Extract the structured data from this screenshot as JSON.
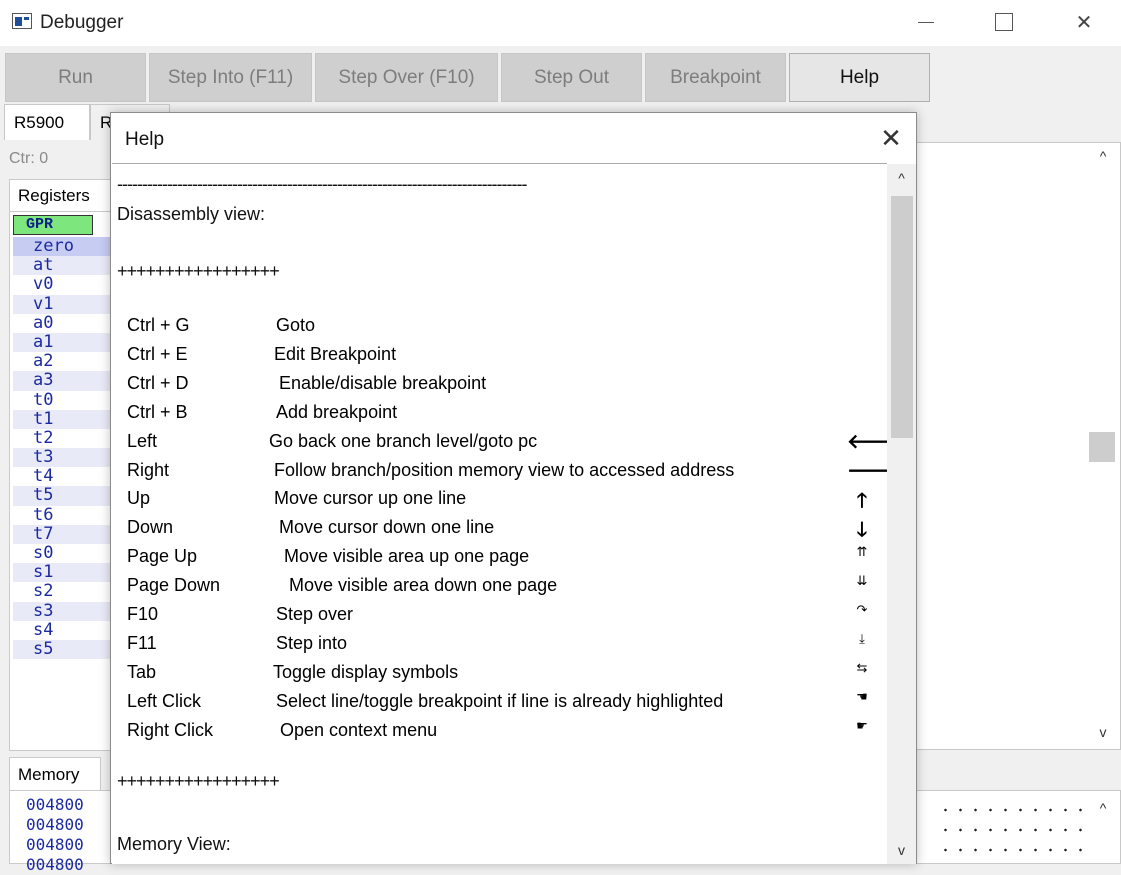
{
  "window": {
    "title": "Debugger",
    "minimize": "—",
    "maximize": "",
    "close": "✕"
  },
  "toolbar": {
    "run": "Run",
    "step_into": "Step Into (F11)",
    "step_over": "Step Over (F10)",
    "step_out": "Step Out",
    "breakpoint": "Breakpoint",
    "help": "Help"
  },
  "tabs": {
    "r5900": "R5900",
    "r3000": "R"
  },
  "counter": "Ctr: 0",
  "registers": {
    "tab_label": "Registers",
    "category": "GPR",
    "names": [
      "zero",
      "at",
      "v0",
      "v1",
      "a0",
      "a1",
      "a2",
      "a3",
      "t0",
      "t1",
      "t2",
      "t3",
      "t4",
      "t5",
      "t6",
      "t7",
      "s0",
      "s1",
      "s2",
      "s3",
      "s4",
      "s5"
    ]
  },
  "memory": {
    "tab_label": "Memory",
    "rows": [
      "004800",
      "004800",
      "004800",
      "004800"
    ]
  },
  "scroll": {
    "up": "^",
    "down": "v"
  },
  "help_dialog": {
    "title": "Help",
    "close": "✕",
    "separator_top": "----------------------------------------------------------------------------------",
    "section_disasm": "Disassembly view:",
    "plus_line": "+++++++++++++++++",
    "section_memory": "Memory View:",
    "shortcuts": [
      {
        "key": "Ctrl + G",
        "desc": "Goto",
        "icon": "",
        "icon_name": ""
      },
      {
        "key": "Ctrl + E",
        "desc": "Edit Breakpoint",
        "icon": "",
        "icon_name": ""
      },
      {
        "key": "Ctrl + D",
        "desc": "Enable/disable breakpoint",
        "icon": "",
        "icon_name": ""
      },
      {
        "key": "Ctrl + B",
        "desc": "Add breakpoint",
        "icon": "",
        "icon_name": ""
      },
      {
        "key": "Left",
        "desc": "Go back one branch level/goto pc",
        "icon": "🡐",
        "icon_name": "arrow-left-icon"
      },
      {
        "key": "Right",
        "desc": "Follow branch/position memory view to accessed address",
        "icon": "🡒",
        "icon_name": "arrow-right-icon"
      },
      {
        "key": "Up",
        "desc": "Move cursor up one line",
        "icon": "🡑",
        "icon_name": "arrow-up-icon"
      },
      {
        "key": "Down",
        "desc": "Move cursor down one line",
        "icon": "🡓",
        "icon_name": "arrow-down-icon"
      },
      {
        "key": "Page Up",
        "desc": "Move visible area up one page",
        "icon": "⇈",
        "icon_name": "page-up-icon"
      },
      {
        "key": "Page Down",
        "desc": "Move visible area down one page",
        "icon": "⇊",
        "icon_name": "page-down-icon"
      },
      {
        "key": "F10",
        "desc": "Step over",
        "icon": "↷",
        "icon_name": "step-over-icon"
      },
      {
        "key": "F11",
        "desc": "Step into",
        "icon": "⤓",
        "icon_name": "step-into-icon"
      },
      {
        "key": "Tab",
        "desc": "Toggle display symbols",
        "icon": "⇆",
        "icon_name": "tab-icon"
      },
      {
        "key": "Left Click",
        "desc": "Select line/toggle breakpoint if line is already highlighted",
        "icon": "☚",
        "icon_name": "left-click-icon"
      },
      {
        "key": "Right Click",
        "desc": "Open context menu",
        "icon": "☛",
        "icon_name": "right-click-icon"
      }
    ]
  }
}
